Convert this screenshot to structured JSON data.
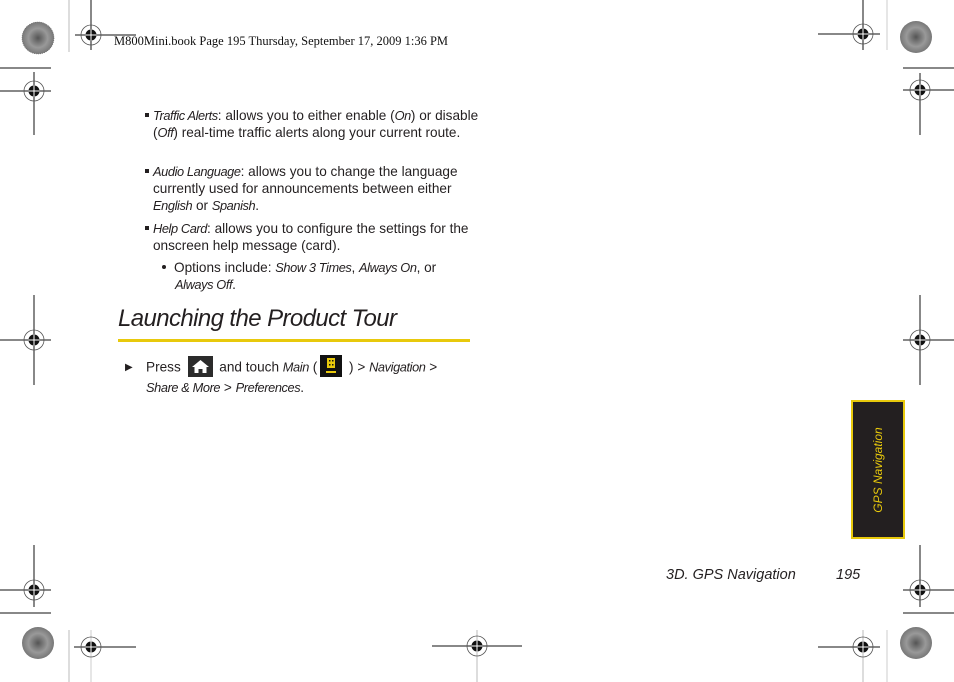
{
  "header": {
    "text": "M800Mini.book  Page 195  Thursday, September 17, 2009  1:36 PM"
  },
  "bullets": [
    {
      "term": "Traffic Alerts",
      "t1": ": allows you to either enable (",
      "on": "On",
      "t2": ") or disable (",
      "off": "Off",
      "t3": ") real-time traffic alerts along your current route."
    },
    {
      "term": "Audio Language",
      "t1": ": allows you to change the language currently used for announcements between either ",
      "english": "English",
      "t2": " or ",
      "spanish": "Spanish",
      "t3": "."
    },
    {
      "term": "Help Card",
      "t1": ": allows you to configure the settings for the onscreen help message (card).",
      "sub": {
        "prefix": "Options include: ",
        "opt1": "Show 3 Times",
        "sep1": ", ",
        "opt2": "Always On",
        "sep2": ", or ",
        "opt3": "Always Off",
        "end": "."
      }
    }
  ],
  "section": {
    "title": "Launching the Product Tour",
    "accent_color": "#e8c90c"
  },
  "step": {
    "press": "Press ",
    "home_icon": "home-key-icon",
    "and_touch": " and touch ",
    "main": "Main",
    "open_paren": " (",
    "main_icon": "main-menu-icon",
    "close_paren": " ) ",
    "gt1": "> ",
    "navigation": "Navigation",
    "gt2": " > ",
    "share_more": "Share & More",
    "gt3": " > ",
    "preferences": "Preferences",
    "end": "."
  },
  "side_tab": {
    "label": "GPS Navigation",
    "bg_color": "#231f20",
    "text_color": "#e8c90c"
  },
  "footer": {
    "section": "3D. GPS Navigation",
    "page": "195"
  }
}
